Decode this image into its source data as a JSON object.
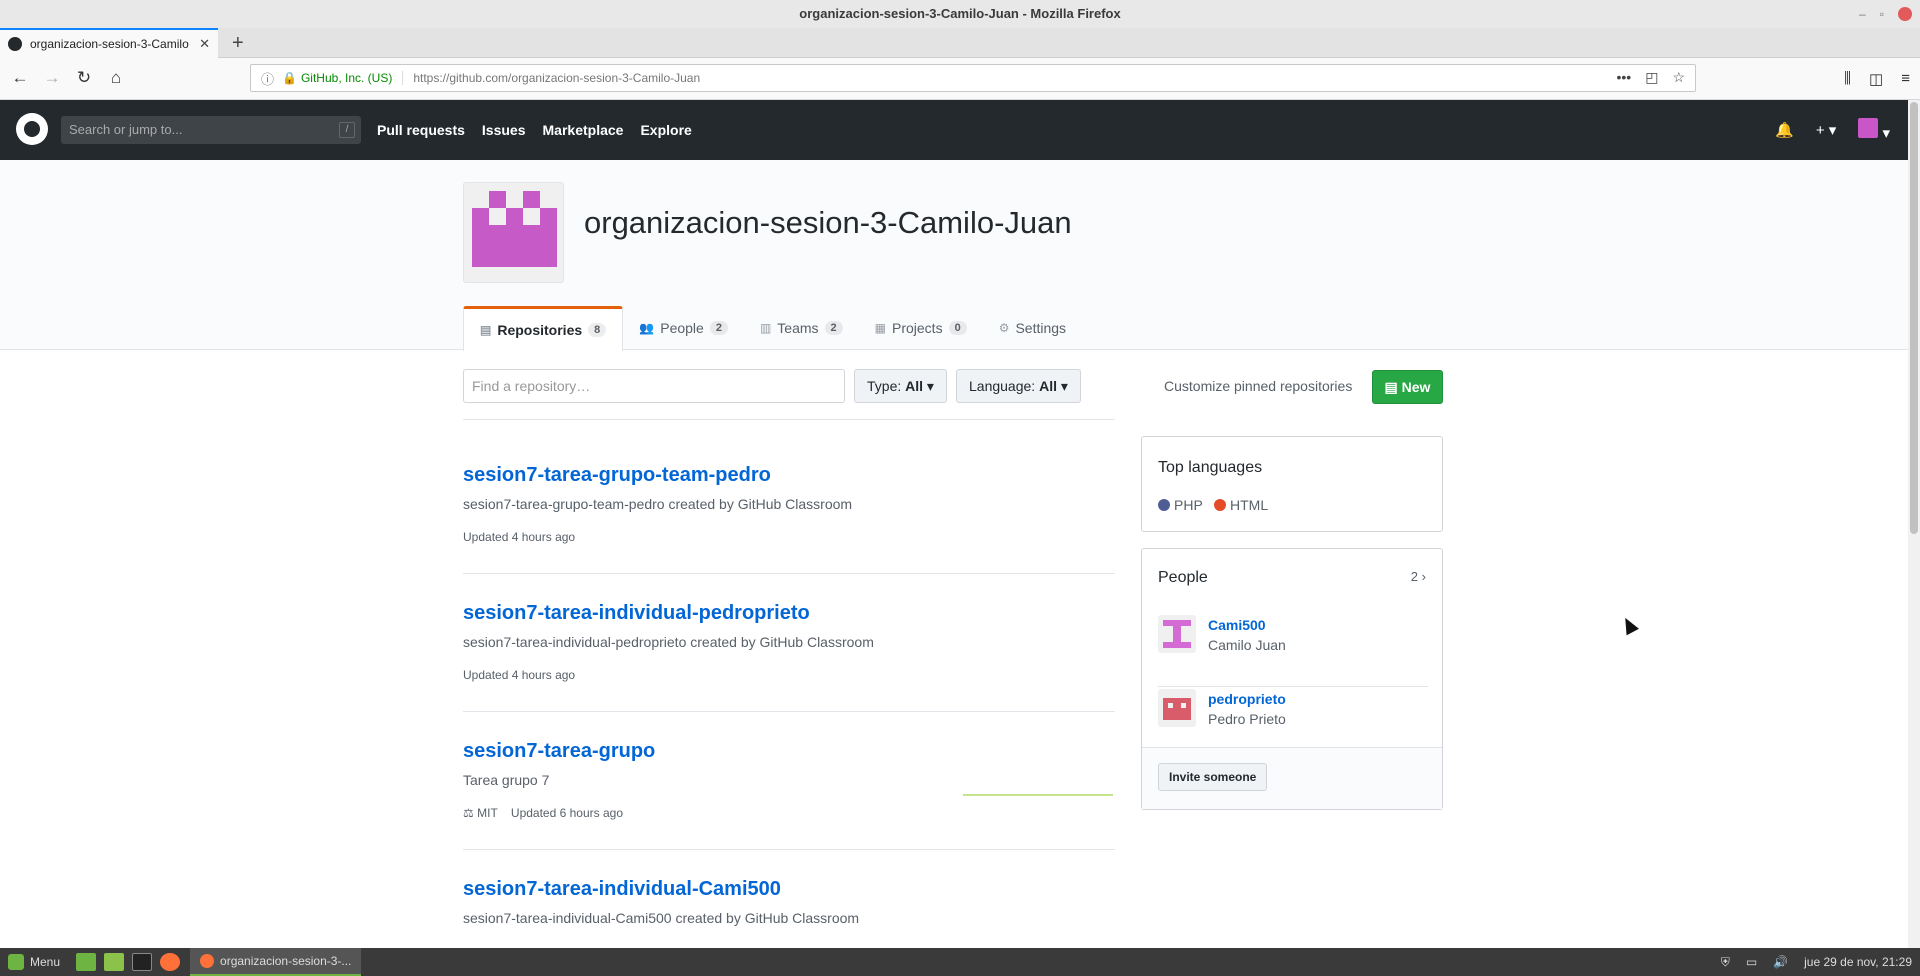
{
  "window": {
    "title": "organizacion-sesion-3-Camilo-Juan - Mozilla Firefox"
  },
  "browser": {
    "tab_title": "organizacion-sesion-3-Camilo",
    "url_prefix": "https://github.com/",
    "url_path": "organizacion-sesion-3-Camilo-Juan",
    "site_identity": "GitHub, Inc. (US)"
  },
  "github": {
    "search_placeholder": "Search or jump to...",
    "search_shortcut": "/",
    "nav": [
      "Pull requests",
      "Issues",
      "Marketplace",
      "Explore"
    ]
  },
  "org": {
    "name": "organizacion-sesion-3-Camilo-Juan",
    "tabs": [
      {
        "label": "Repositories",
        "count": "8",
        "icon": "repo-icon"
      },
      {
        "label": "People",
        "count": "2",
        "icon": "people-icon"
      },
      {
        "label": "Teams",
        "count": "2",
        "icon": "teams-icon"
      },
      {
        "label": "Projects",
        "count": "0",
        "icon": "project-icon"
      },
      {
        "label": "Settings",
        "count": "",
        "icon": "gear-icon"
      }
    ]
  },
  "filters": {
    "find_placeholder": "Find a repository…",
    "type_label": "Type:",
    "type_value": "All",
    "language_label": "Language:",
    "language_value": "All",
    "customize": "Customize pinned repositories",
    "new_button": "New"
  },
  "repos": [
    {
      "name": "sesion7-tarea-grupo-team-pedro",
      "desc": "sesion7-tarea-grupo-team-pedro created by GitHub Classroom",
      "meta": "Updated 4 hours ago",
      "license": ""
    },
    {
      "name": "sesion7-tarea-individual-pedroprieto",
      "desc": "sesion7-tarea-individual-pedroprieto created by GitHub Classroom",
      "meta": "Updated 4 hours ago",
      "license": ""
    },
    {
      "name": "sesion7-tarea-grupo",
      "desc": "Tarea grupo 7",
      "meta": "Updated 6 hours ago",
      "license": "MIT"
    },
    {
      "name": "sesion7-tarea-individual-Cami500",
      "desc": "sesion7-tarea-individual-Cami500 created by GitHub Classroom",
      "meta": "",
      "license": ""
    }
  ],
  "top_languages": {
    "title": "Top languages",
    "items": [
      {
        "name": "PHP",
        "color": "#4F5D95"
      },
      {
        "name": "HTML",
        "color": "#e34c26"
      }
    ]
  },
  "people": {
    "title": "People",
    "count": "2",
    "members": [
      {
        "login": "Cami500",
        "name": "Camilo Juan",
        "color": "#d46ad4"
      },
      {
        "login": "pedroprieto",
        "name": "Pedro Prieto",
        "color": "#d95c6a"
      }
    ],
    "invite": "Invite someone"
  },
  "taskbar": {
    "menu": "Menu",
    "window": "organizacion-sesion-3-...",
    "clock": "jue 29 de nov, 21:29"
  }
}
